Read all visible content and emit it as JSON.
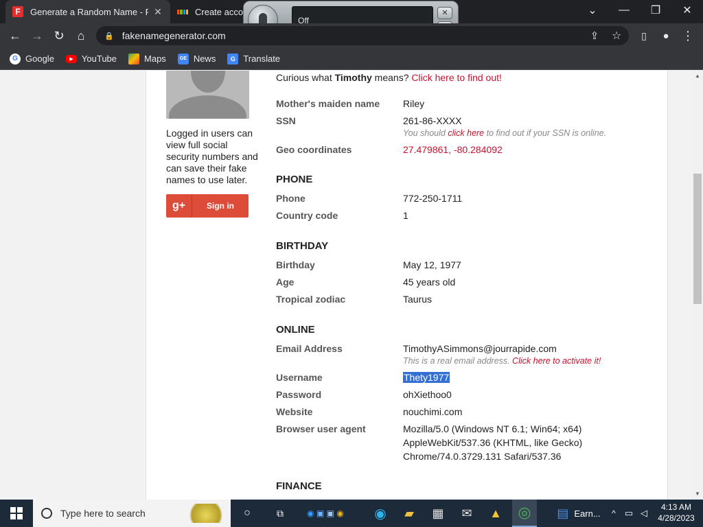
{
  "tabs": [
    {
      "title": "Generate a Random Name - Fake",
      "favicon": "F"
    },
    {
      "title": "Create accou"
    }
  ],
  "speech": {
    "status": "Off"
  },
  "address": {
    "url": "fakenamegenerator.com"
  },
  "bookmarks": [
    "Google",
    "YouTube",
    "Maps",
    "News",
    "Translate"
  ],
  "sidebar": {
    "logged_in_text": "Logged in users can view full social security numbers and can save their fake names to use later.",
    "signin_label": "Sign in",
    "gplus_label": "g+"
  },
  "curious": {
    "prefix": "Curious what ",
    "name": "Timothy",
    "middle": " means? ",
    "link": "Click here to find out!"
  },
  "fields": {
    "maiden_label": "Mother's maiden name",
    "maiden": "Riley",
    "ssn_label": "SSN",
    "ssn": "261-86-XXXX",
    "ssn_note_a": "You should ",
    "ssn_note_link": "click here",
    "ssn_note_b": " to find out if your SSN is online.",
    "geo_label": "Geo coordinates",
    "geo": "27.479861, -80.284092",
    "phone_section": "PHONE",
    "phone_label": "Phone",
    "phone": "772-250-1711",
    "cc_label": "Country code",
    "cc": "1",
    "birthday_section": "BIRTHDAY",
    "birthday_label": "Birthday",
    "birthday": "May 12, 1977",
    "age_label": "Age",
    "age": "45 years old",
    "zodiac_label": "Tropical zodiac",
    "zodiac": "Taurus",
    "online_section": "ONLINE",
    "email_label": "Email Address",
    "email": "TimothyASimmons@jourrapide.com",
    "email_note_a": "This is a real email address. ",
    "email_note_link": "Click here to activate it!",
    "username_label": "Username",
    "username": "Thety1977",
    "password_label": "Password",
    "password": "ohXiethoo0",
    "website_label": "Website",
    "website": "nouchimi.com",
    "ua_label": "Browser user agent",
    "ua_1": "Mozilla/5.0 (Windows NT 6.1; Win64; x64)",
    "ua_2": "AppleWebKit/537.36 (KHTML, like Gecko)",
    "ua_3": "Chrome/74.0.3729.131 Safari/537.36",
    "finance_section": "FINANCE"
  },
  "taskbar": {
    "search_placeholder": "Type here to search",
    "app_label": "Earn...",
    "time": "4:13 AM",
    "date": "4/28/2023"
  }
}
